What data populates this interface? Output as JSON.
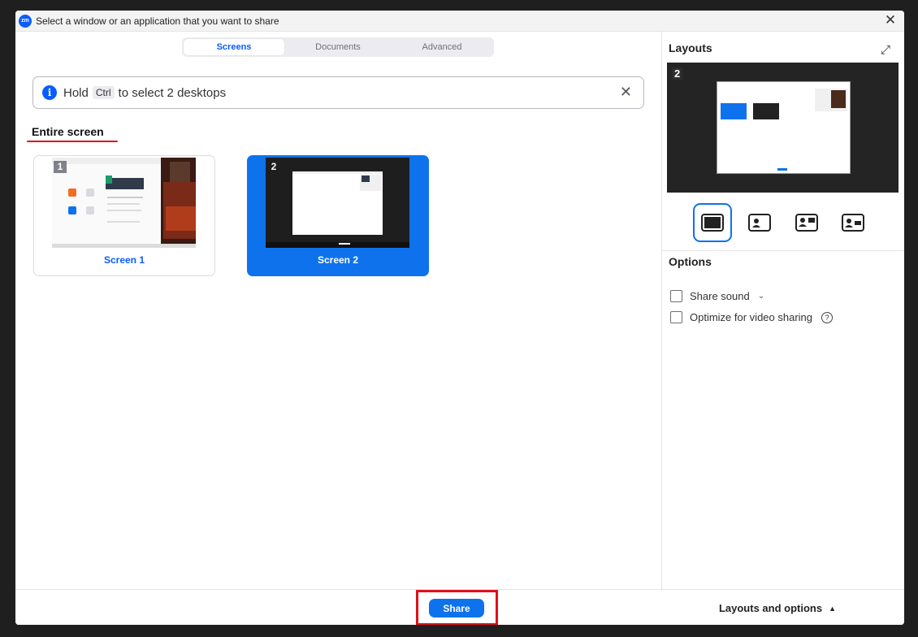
{
  "window": {
    "title": "Select a window or an application that you want to share",
    "logo_text": "zm",
    "close_icon": "✕"
  },
  "tabs": [
    {
      "label": "Screens",
      "active": true
    },
    {
      "label": "Documents",
      "active": false
    },
    {
      "label": "Advanced",
      "active": false
    }
  ],
  "info_bar": {
    "prefix": "Hold",
    "key": "Ctrl",
    "suffix": "to select 2 desktops",
    "icon": "i",
    "close_icon": "✕"
  },
  "section": {
    "title": "Entire screen"
  },
  "screens": [
    {
      "number": "1",
      "label": "Screen 1",
      "selected": false
    },
    {
      "number": "2",
      "label": "Screen 2",
      "selected": true
    }
  ],
  "side": {
    "layouts_title": "Layouts",
    "expand_icon": "⤢",
    "preview_number": "2",
    "options_title": "Options",
    "options": [
      {
        "label": "Share sound",
        "checked": false,
        "has_dropdown": true
      },
      {
        "label": "Optimize for video sharing",
        "checked": false,
        "has_help": true
      }
    ],
    "dropdown_icon": "⌄",
    "help_icon": "?"
  },
  "footer": {
    "share_label": "Share",
    "layouts_label": "Layouts and options",
    "caret_icon": "▲"
  },
  "colors": {
    "accent": "#0e72ed",
    "highlight": "#e0101a"
  }
}
